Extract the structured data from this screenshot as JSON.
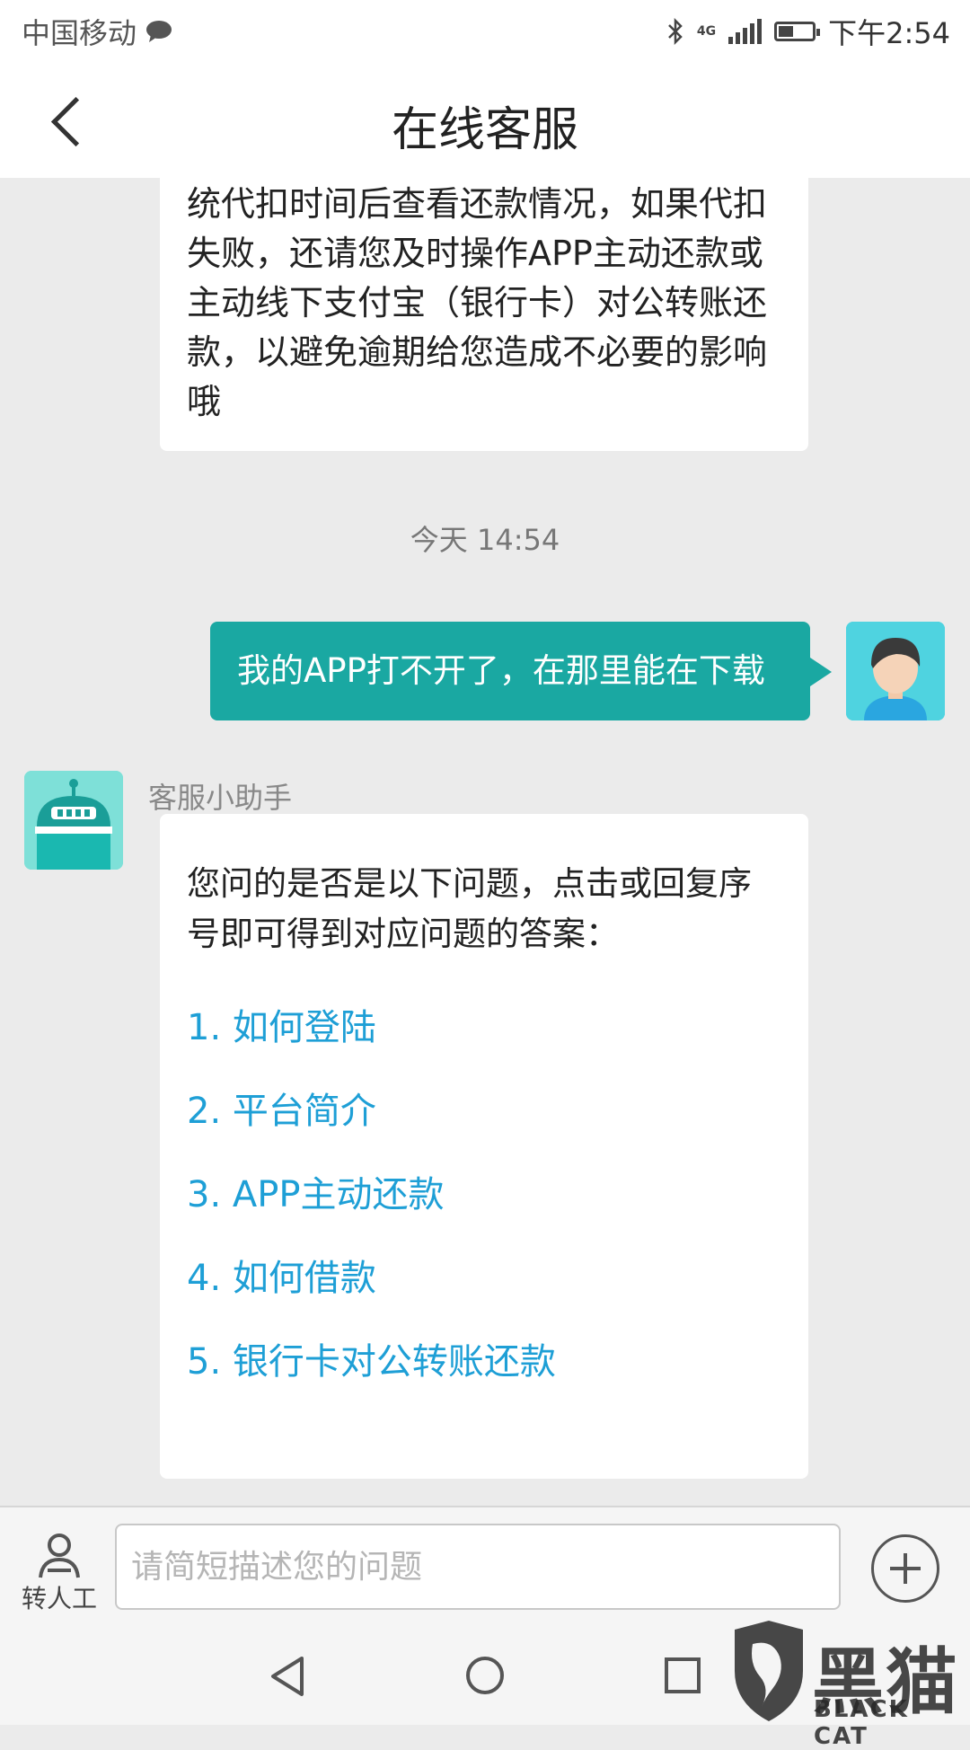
{
  "status_bar": {
    "carrier": "中国移动",
    "network": "4G",
    "time": "下午2:54",
    "battery_level": 0.4
  },
  "header": {
    "title": "在线客服",
    "back_icon": "chevron-left-icon"
  },
  "messages": {
    "previous": "统代扣时间后查看还款情况，如果代扣失败，还请您及时操作APP主动还款或主动线下支付宝（银行卡）对公转账还款，以避免逾期给您造成不必要的影响哦",
    "timestamp": "今天 14:54",
    "user": "我的APP打不开了，在那里能在下载",
    "bot_name": "客服小助手",
    "bot_intro": "您问的是否是以下问题，点击或回复序号即可得到对应问题的答案：",
    "options": [
      "1. 如何登陆",
      "2. 平台简介",
      "3. APP主动还款",
      "4. 如何借款",
      "5. 银行卡对公转账还款"
    ]
  },
  "input_bar": {
    "transfer_label": "转人工",
    "placeholder": "请简短描述您的问题"
  },
  "watermark": {
    "cn": "黑猫",
    "en": "BLACK CAT"
  },
  "colors": {
    "user_bubble": "#1aa8a2",
    "option_link": "#1e9fd6",
    "background": "#ebebeb"
  }
}
